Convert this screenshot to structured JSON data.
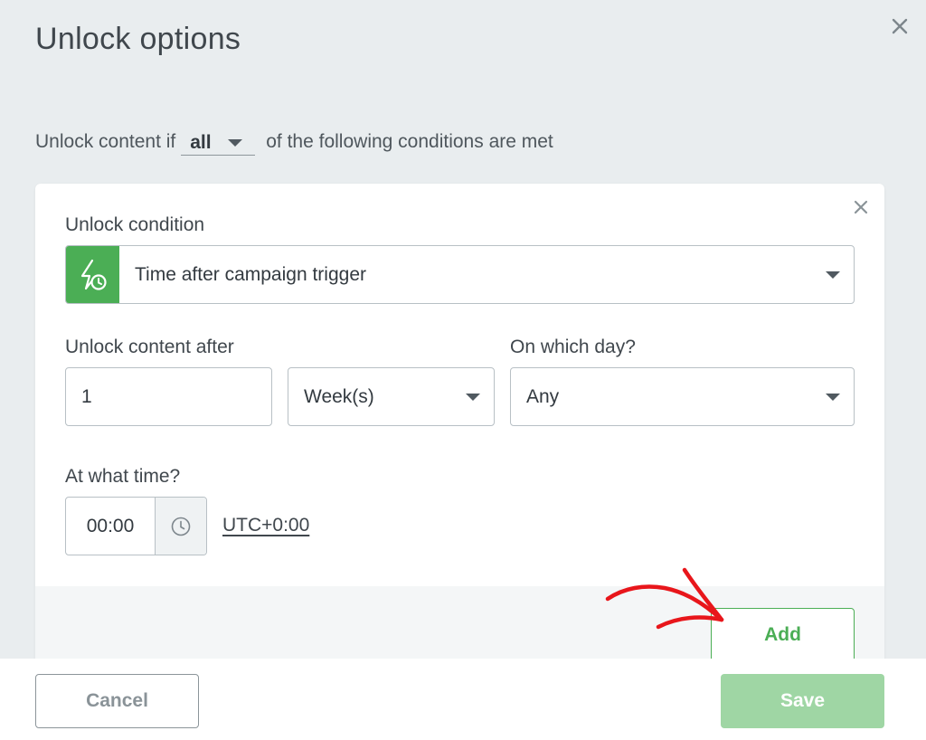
{
  "modal": {
    "title": "Unlock options",
    "close_icon": "close-icon"
  },
  "rule": {
    "prefix": "Unlock content if",
    "match_value": "all",
    "suffix": "of the following conditions are met"
  },
  "condition": {
    "label": "Unlock condition",
    "trigger_icon": "lightning-clock-icon",
    "trigger_value": "Time after campaign trigger",
    "delay_label": "Unlock content after",
    "delay_amount": "1",
    "delay_unit": "Week(s)",
    "day_label": "On which day?",
    "day_value": "Any",
    "time_label": "At what time?",
    "time_value": "00:00",
    "timezone": "UTC+0:00",
    "add_label": "Add"
  },
  "footer": {
    "cancel_label": "Cancel",
    "save_label": "Save"
  },
  "colors": {
    "accent_green": "#4bae55",
    "save_disabled": "#9fd6a4",
    "annotation_arrow": "#e8161b",
    "modal_background": "#e9edef"
  }
}
